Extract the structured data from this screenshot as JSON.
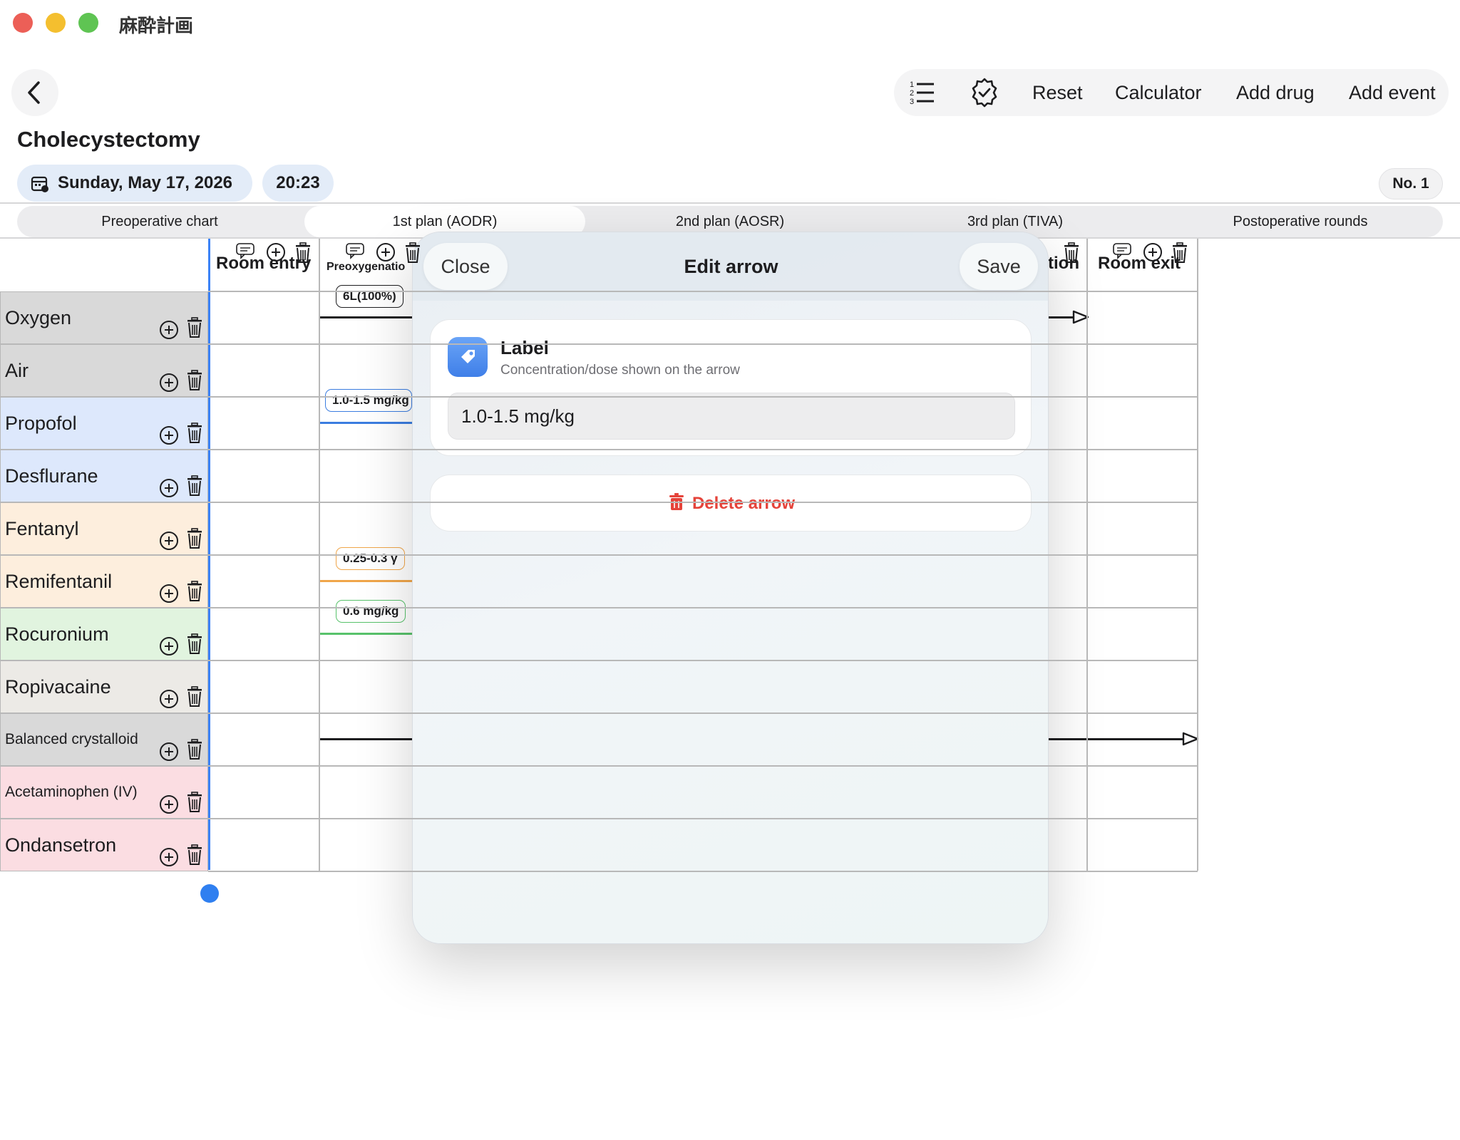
{
  "window": {
    "title": "麻酔計画",
    "colors": {
      "close": "#ec5f57",
      "minimize": "#f4bf2f",
      "maximize": "#5fc453"
    }
  },
  "toolbar": {
    "reset": "Reset",
    "calculator": "Calculator",
    "add_drug": "Add drug",
    "add_event": "Add event"
  },
  "page": {
    "title": "Cholecystectomy",
    "date": "Sunday, May 17, 2026",
    "time": "20:23",
    "number": "No. 1"
  },
  "tabs": [
    {
      "label": "Preoperative chart",
      "active": false
    },
    {
      "label": "1st plan (AODR)",
      "active": true
    },
    {
      "label": "2nd plan (AOSR)",
      "active": false
    },
    {
      "label": "3rd plan (TIVA)",
      "active": false
    },
    {
      "label": "Postoperative rounds",
      "active": false
    }
  ],
  "columns": [
    {
      "label": "Room entry"
    },
    {
      "label": "Preoxygenatio"
    },
    {
      "label": "tion"
    },
    {
      "label": "Room exit"
    }
  ],
  "rows": [
    {
      "label": "Oxygen",
      "color": "#d9d9d9"
    },
    {
      "label": "Air",
      "color": "#d9d9d9"
    },
    {
      "label": "Propofol",
      "color": "#dde8fc"
    },
    {
      "label": "Desflurane",
      "color": "#dde8fc"
    },
    {
      "label": "Fentanyl",
      "color": "#fdeedd"
    },
    {
      "label": "Remifentanil",
      "color": "#fdeedd"
    },
    {
      "label": "Rocuronium",
      "color": "#e1f4df"
    },
    {
      "label": "Ropivacaine",
      "color": "#eceae6"
    },
    {
      "label": "Balanced crystalloid",
      "color": "#d9d9d9"
    },
    {
      "label": "Acetaminophen (IV)",
      "color": "#fbdde2"
    },
    {
      "label": "Ondansetron",
      "color": "#fbdde2"
    }
  ],
  "chips": {
    "oxygen": "6L(100%)",
    "propofol": "1.0-1.5 mg/kg",
    "remifentanil": "0.25-0.3 γ",
    "rocuronium": "0.6 mg/kg"
  },
  "modal": {
    "title": "Edit arrow",
    "close": "Close",
    "save": "Save",
    "label_title": "Label",
    "label_subtitle": "Concentration/dose shown on the arrow",
    "label_value": "1.0-1.5 mg/kg",
    "delete": "Delete arrow"
  }
}
